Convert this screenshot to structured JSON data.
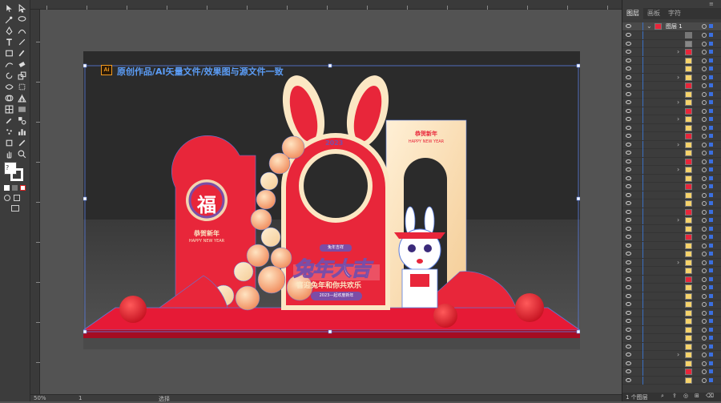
{
  "artwork": {
    "header_text": "原创作品/AI矢量文件/效果图与源文件一致",
    "ai_badge": "Ai",
    "fu_char": "福",
    "left_greeting": "恭贺新年",
    "left_english": "HAPPY NEW YEAR",
    "right_greeting": "恭贺新年",
    "right_english": "HAPPY NEW YEAR",
    "year_label": "2023",
    "small_tag": "兔年吉祥",
    "main_title": "兔年大吉",
    "subtitle": "喜迎兔年和你共欢乐",
    "ribbon": "2023—起欢度新年"
  },
  "panel": {
    "tabs": [
      "图层",
      "画板",
      "字符"
    ],
    "layer_name": "图层 1",
    "footer_label": "1 个图层"
  },
  "status": {
    "zoom": "50%",
    "page": "1",
    "tool": "选择"
  },
  "colors": {
    "accent": "#e8263a",
    "selection": "#3a6fe0",
    "cream": "#fbe7c4"
  }
}
